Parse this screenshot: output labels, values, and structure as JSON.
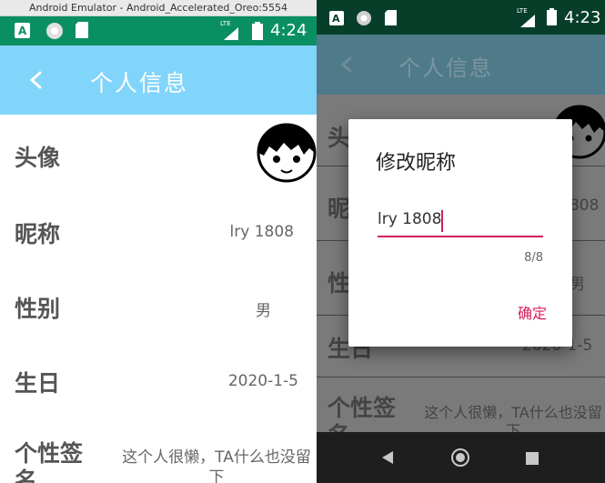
{
  "emulator": {
    "title": "Android Emulator - Android_Accelerated_Oreo:5554"
  },
  "left": {
    "status": {
      "time": "4:24",
      "network": "LTE"
    },
    "appbar": {
      "title": "个人信息"
    },
    "rows": [
      {
        "label": "头像",
        "value": ""
      },
      {
        "label": "昵称",
        "value": "lry 1808"
      },
      {
        "label": "性别",
        "value": "男"
      },
      {
        "label": "生日",
        "value": "2020-1-5"
      },
      {
        "label": "个性签名",
        "value": "这个人很懒，TA什么也没留下"
      }
    ]
  },
  "right": {
    "status": {
      "time": "4:23",
      "network": "LTE"
    },
    "appbar": {
      "title": "个人信息"
    },
    "rows": [
      {
        "label": "头像",
        "value": ""
      },
      {
        "label": "昵称",
        "value": "lry 1808"
      },
      {
        "label": "性别",
        "value": "男"
      },
      {
        "label": "生日",
        "value": "2020-1-5"
      },
      {
        "label": "个性签名",
        "value": "这个人很懒，TA什么也没留下"
      }
    ],
    "dialog": {
      "title": "修改昵称",
      "input_value": "lry 1808",
      "counter": "8/8",
      "confirm_label": "确定"
    }
  },
  "colors": {
    "appbar_left": "#81d4fa",
    "statusbar_left": "#0a8f63",
    "accent": "#d81b60"
  }
}
